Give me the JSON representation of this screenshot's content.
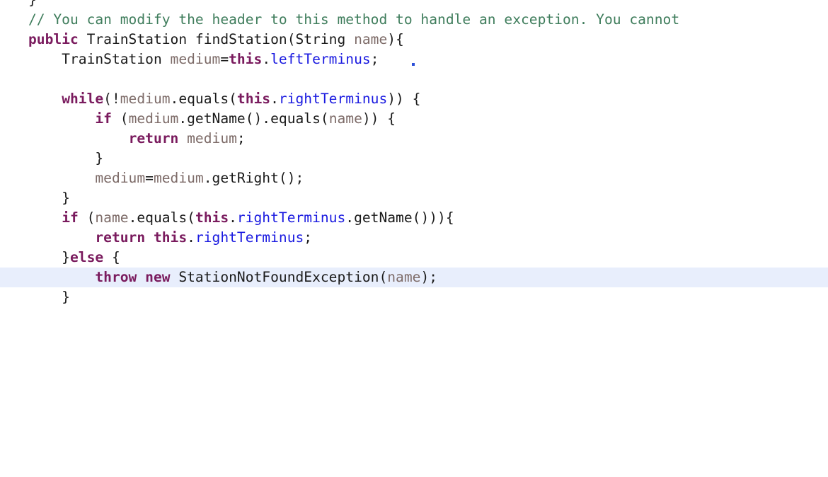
{
  "editor": {
    "language": "Java",
    "background_color": "#ffffff",
    "current_line_highlight_color": "#e8eefc",
    "font_size_px": 19.6,
    "line_height_px": 28,
    "indent_spaces": 4,
    "theme_colors": {
      "plain": "#1a1a1a",
      "keyword": "#7a1b5e",
      "comment": "#3f7d5c",
      "field": "#1a1ae0",
      "variable": "#7d6b68"
    }
  },
  "code": {
    "lines": [
      {
        "id": "line-clipped-brace",
        "clipped_top": true,
        "current": false,
        "tokens": [
          {
            "t": "}",
            "k": "plain"
          }
        ]
      },
      {
        "id": "line-comment",
        "truncated_right": true,
        "current": false,
        "tokens": [
          {
            "t": "// You can modify the header to this method to handle an exception. You cannot",
            "k": "comment"
          }
        ]
      },
      {
        "id": "line-method-signature",
        "current": false,
        "tokens": [
          {
            "t": "public",
            "k": "keyword"
          },
          {
            "t": " TrainStation findStation(String ",
            "k": "plain"
          },
          {
            "t": "name",
            "k": "variable"
          },
          {
            "t": "){",
            "k": "plain"
          }
        ]
      },
      {
        "id": "line-declare-medium",
        "current": false,
        "tokens": [
          {
            "t": "    TrainStation ",
            "k": "plain"
          },
          {
            "t": "medium",
            "k": "variable"
          },
          {
            "t": "=",
            "k": "plain"
          },
          {
            "t": "this",
            "k": "keyword"
          },
          {
            "t": ".",
            "k": "plain"
          },
          {
            "t": "leftTerminus",
            "k": "field"
          },
          {
            "t": ";",
            "k": "plain"
          }
        ]
      },
      {
        "id": "line-blank-1",
        "current": false,
        "tokens": [
          {
            "t": "",
            "k": "plain"
          }
        ]
      },
      {
        "id": "line-while",
        "current": false,
        "tokens": [
          {
            "t": "    ",
            "k": "plain"
          },
          {
            "t": "while",
            "k": "keyword"
          },
          {
            "t": "(!",
            "k": "plain"
          },
          {
            "t": "medium",
            "k": "variable"
          },
          {
            "t": ".equals(",
            "k": "plain"
          },
          {
            "t": "this",
            "k": "keyword"
          },
          {
            "t": ".",
            "k": "plain"
          },
          {
            "t": "rightTerminus",
            "k": "field"
          },
          {
            "t": ")) {",
            "k": "plain"
          }
        ]
      },
      {
        "id": "line-if-getname",
        "current": false,
        "tokens": [
          {
            "t": "        ",
            "k": "plain"
          },
          {
            "t": "if",
            "k": "keyword"
          },
          {
            "t": " (",
            "k": "plain"
          },
          {
            "t": "medium",
            "k": "variable"
          },
          {
            "t": ".getName().equals(",
            "k": "plain"
          },
          {
            "t": "name",
            "k": "variable"
          },
          {
            "t": ")) {",
            "k": "plain"
          }
        ]
      },
      {
        "id": "line-return-medium",
        "current": false,
        "tokens": [
          {
            "t": "            ",
            "k": "plain"
          },
          {
            "t": "return",
            "k": "keyword"
          },
          {
            "t": " ",
            "k": "plain"
          },
          {
            "t": "medium",
            "k": "variable"
          },
          {
            "t": ";",
            "k": "plain"
          }
        ]
      },
      {
        "id": "line-close-if",
        "current": false,
        "tokens": [
          {
            "t": "        }",
            "k": "plain"
          }
        ]
      },
      {
        "id": "line-advance-medium",
        "current": false,
        "tokens": [
          {
            "t": "        ",
            "k": "plain"
          },
          {
            "t": "medium",
            "k": "variable"
          },
          {
            "t": "=",
            "k": "plain"
          },
          {
            "t": "medium",
            "k": "variable"
          },
          {
            "t": ".getRight();",
            "k": "plain"
          }
        ]
      },
      {
        "id": "line-close-while",
        "current": false,
        "tokens": [
          {
            "t": "    }",
            "k": "plain"
          }
        ]
      },
      {
        "id": "line-if-terminus",
        "current": false,
        "tokens": [
          {
            "t": "    ",
            "k": "plain"
          },
          {
            "t": "if",
            "k": "keyword"
          },
          {
            "t": " (",
            "k": "plain"
          },
          {
            "t": "name",
            "k": "variable"
          },
          {
            "t": ".equals(",
            "k": "plain"
          },
          {
            "t": "this",
            "k": "keyword"
          },
          {
            "t": ".",
            "k": "plain"
          },
          {
            "t": "rightTerminus",
            "k": "field"
          },
          {
            "t": ".getName())){",
            "k": "plain"
          }
        ]
      },
      {
        "id": "line-return-terminus",
        "current": false,
        "tokens": [
          {
            "t": "        ",
            "k": "plain"
          },
          {
            "t": "return",
            "k": "keyword"
          },
          {
            "t": " ",
            "k": "plain"
          },
          {
            "t": "this",
            "k": "keyword"
          },
          {
            "t": ".",
            "k": "plain"
          },
          {
            "t": "rightTerminus",
            "k": "field"
          },
          {
            "t": ";",
            "k": "plain"
          }
        ]
      },
      {
        "id": "line-else",
        "current": false,
        "tokens": [
          {
            "t": "    }",
            "k": "plain"
          },
          {
            "t": "else",
            "k": "keyword"
          },
          {
            "t": " {",
            "k": "plain"
          }
        ]
      },
      {
        "id": "line-throw",
        "current": true,
        "tokens": [
          {
            "t": "        ",
            "k": "plain"
          },
          {
            "t": "throw",
            "k": "keyword"
          },
          {
            "t": " ",
            "k": "plain"
          },
          {
            "t": "new",
            "k": "keyword"
          },
          {
            "t": " StationNotFoundException(",
            "k": "plain"
          },
          {
            "t": "name",
            "k": "variable"
          },
          {
            "t": ");",
            "k": "plain"
          }
        ]
      },
      {
        "id": "line-close-else",
        "current": false,
        "tokens": [
          {
            "t": "    }",
            "k": "plain"
          }
        ]
      }
    ]
  }
}
